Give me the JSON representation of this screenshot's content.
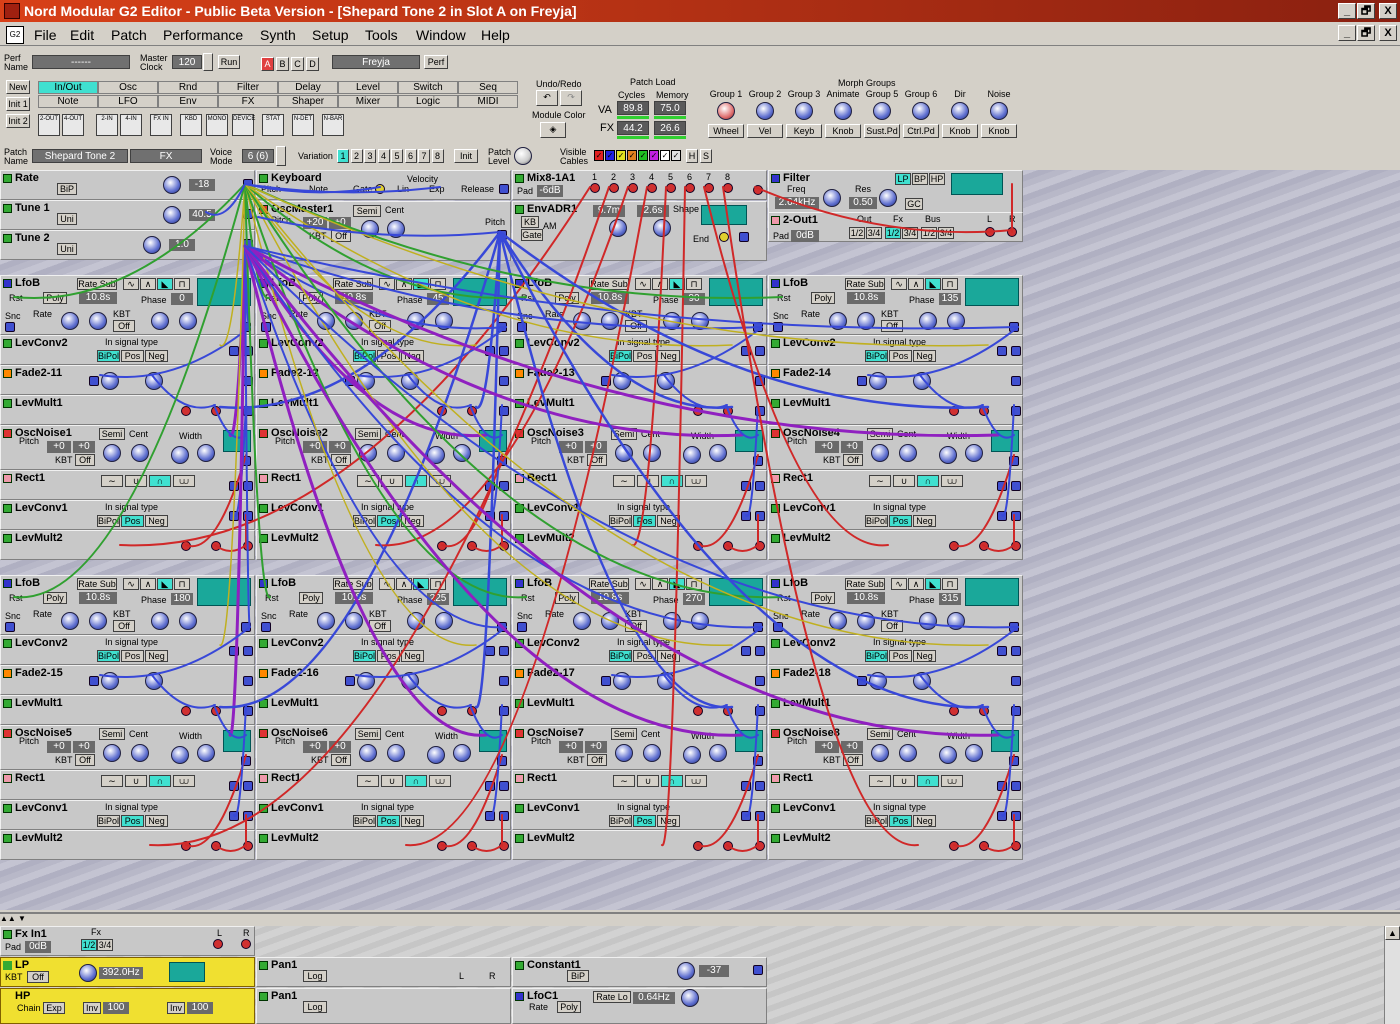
{
  "window": {
    "title": "Nord Modular G2 Editor - Public Beta Version - [Shepard Tone 2 in Slot A on Freyja]",
    "minimize": "_",
    "restore": "🗗",
    "close": "X"
  },
  "menu": {
    "icon": "G2",
    "items": [
      "File",
      "Edit",
      "Patch",
      "Performance",
      "Synth",
      "Setup",
      "Tools",
      "Window",
      "Help"
    ]
  },
  "perf": {
    "name_label": "Perf Name",
    "name_value": "------",
    "clock_label": "Master Clock",
    "clock_value": "120",
    "run": "Run",
    "slots": [
      "A",
      "B",
      "C",
      "D"
    ],
    "synth_name": "Freyja",
    "perf_btn": "Perf"
  },
  "toolbar": {
    "init": [
      "New",
      "Init 1",
      "Init 2"
    ],
    "categories": [
      [
        "In/Out",
        "Osc",
        "Rnd",
        "Filter",
        "Delay",
        "Level",
        "Switch",
        "Seq"
      ],
      [
        "Note",
        "LFO",
        "Env",
        "FX",
        "Shaper",
        "Mixer",
        "Logic",
        "MIDI"
      ]
    ],
    "io_icons": [
      "2-OUT",
      "4-OUT",
      "2-IN",
      "4-IN",
      "FX IN",
      "KBD",
      "MONO",
      "DEVICE",
      "STAT",
      "N-DET",
      "N-BAR"
    ],
    "undo_redo": "Undo/Redo",
    "module_color": "Module Color",
    "patch_load": "Patch Load",
    "cycles": "Cycles",
    "memory": "Memory",
    "va": "VA",
    "fx": "FX",
    "va_cycles": "89.8",
    "va_memory": "75.0",
    "fx_cycles": "44.2",
    "fx_memory": "26.6",
    "morph_title": "Morph Groups",
    "morph_groups": [
      {
        "name": "Group 1",
        "src": "Wheel"
      },
      {
        "name": "Group 2",
        "src": "Vel"
      },
      {
        "name": "Group 3",
        "src": "Keyb"
      },
      {
        "name": "Animate",
        "src": "Knob"
      },
      {
        "name": "Group 5",
        "src": "Sust.Pd"
      },
      {
        "name": "Group 6",
        "src": "Ctrl.Pd"
      },
      {
        "name": "Dir",
        "src": "Knob"
      },
      {
        "name": "Noise",
        "src": "Knob"
      }
    ]
  },
  "patchbar": {
    "label": "Patch Name",
    "name": "Shepard Tone 2",
    "slot": "FX",
    "voice_label": "Voice Mode",
    "voice": "6 (6)",
    "variation_label": "Variation",
    "variations": [
      "1",
      "2",
      "3",
      "4",
      "5",
      "6",
      "7",
      "8"
    ],
    "init": "Init",
    "level_label": "Patch Level",
    "cables_label": "Visible Cables",
    "h": "H",
    "s": "S"
  },
  "modules": {
    "rate": {
      "title": "Rate",
      "mode": "BiP",
      "value": "-18"
    },
    "tune1": {
      "title": "Tune 1",
      "mode": "Uni",
      "value": "40.5"
    },
    "tune2": {
      "title": "Tune 2",
      "mode": "Uni",
      "value": "1.0"
    },
    "keyboard": {
      "title": "Keyboard",
      "pitch": "Pitch",
      "note": "Note",
      "gate": "Gate",
      "velocity": "Velocity",
      "lin": "Lin",
      "exp": "Exp",
      "release": "Release"
    },
    "oscmaster": {
      "title": "OscMaster1",
      "pitch": "Pitch",
      "semi": "Semi",
      "cent": "Cent",
      "val": "+20",
      "val2": "+0",
      "kbt": "KBT",
      "off": "Off",
      "pitch2": "Pitch"
    },
    "mix": {
      "title": "Mix8-1A1",
      "pad": "Pad",
      "pad_value": "-6dB",
      "channels": [
        "1",
        "2",
        "3",
        "4",
        "5",
        "6",
        "7",
        "8"
      ]
    },
    "env": {
      "title": "EnvADR1",
      "kb": "KB",
      "am": "AM",
      "gate": "Gate",
      "a": "9.7m",
      "d": "2.6s",
      "shape": "Shape",
      "end": "End"
    },
    "filter": {
      "title": "Filter",
      "freq": "Freq",
      "freq_value": "2.64kHz",
      "res": "Res",
      "res_value": "0.50",
      "gc": "GC",
      "modes": [
        "LP",
        "BP",
        "HP"
      ],
      "db": "12"
    },
    "out": {
      "title": "2-Out1",
      "pad": "Pad",
      "pad_value": "0dB",
      "out": "Out",
      "fx": "Fx",
      "bus": "Bus",
      "opts1": [
        "1/2",
        "3/4"
      ],
      "opts2": [
        "1/2",
        "3/4"
      ],
      "opts3": [
        "1/2",
        "3/4"
      ],
      "l": "L",
      "r": "R"
    }
  },
  "columns": [
    {
      "lfo": "LfoB",
      "fade1": "Fade2-11",
      "osc": "OscNoise1",
      "fade2": "Fade2-15",
      "osc2": "OscNoise5",
      "phase1": "0",
      "phase2": "180"
    },
    {
      "lfo": "LfoB",
      "fade1": "Fade2-12",
      "osc": "OscNoise2",
      "fade2": "Fade2-16",
      "osc2": "OscNoise6",
      "phase1": "45",
      "phase2": "225"
    },
    {
      "lfo": "LfoB",
      "fade1": "Fade2-13",
      "osc": "OscNoise3",
      "fade2": "Fade2-17",
      "osc2": "OscNoise7",
      "phase1": "90",
      "phase2": "270"
    },
    {
      "lfo": "LfoB",
      "fade1": "Fade2-14",
      "osc": "OscNoise4",
      "fade2": "Fade2-18",
      "osc2": "OscNoise8",
      "phase1": "135",
      "phase2": "315"
    }
  ],
  "lfo_common": {
    "rate_sub": "Rate Sub",
    "rst": "Rst",
    "poly": "Poly",
    "rate_value": "10.8s",
    "phase": "Phase",
    "snc": "Snc",
    "rate": "Rate",
    "kbt": "KBT",
    "off": "Off"
  },
  "levconv": {
    "title": "LevConv2",
    "title2": "LevConv1",
    "signal": "In signal type",
    "opts": [
      "BiPol",
      "Pos",
      "Neg"
    ]
  },
  "levmult": {
    "title": "LevMult1",
    "title2": "LevMult2"
  },
  "rect": {
    "title": "Rect1"
  },
  "osc_common": {
    "pitch": "Pitch",
    "semi": "Semi",
    "cent": "Cent",
    "val": "+0",
    "val2": "+0",
    "kbt": "KBT",
    "off": "Off",
    "width": "Width"
  },
  "fx": {
    "fxin": {
      "title": "Fx In1",
      "fx": "Fx",
      "pad": "Pad",
      "pad_value": "0dB",
      "opts": [
        "1/2",
        "3/4"
      ],
      "l": "L",
      "r": "R"
    },
    "lp": {
      "title": "LP",
      "kbt": "KBT",
      "off": "Off",
      "freq": "392.0Hz"
    },
    "hp": {
      "title": "HP",
      "chain": "Chain",
      "exp": "Exp",
      "inv": "Inv",
      "value": "100",
      "inv2": "Inv",
      "value2": "100"
    },
    "pan1": {
      "title": "Pan1",
      "log": "Log",
      "l": "L",
      "r": "R"
    },
    "pan2": {
      "title": "Pan1",
      "log": "Log"
    },
    "constant": {
      "title": "Constant1",
      "mode": "BiP",
      "value": "-37"
    },
    "lfoc": {
      "title": "LfoC1",
      "rate": "Rate",
      "poly": "Poly",
      "rate_lo": "Rate Lo",
      "value": "0.64Hz"
    }
  },
  "colors": {
    "accent": "#40e0d0",
    "cable_blue": "#3848d8",
    "cable_red": "#d02828",
    "cable_green": "#30a030",
    "cable_purple": "#9020c0",
    "cable_yellow": "#c0b020"
  }
}
